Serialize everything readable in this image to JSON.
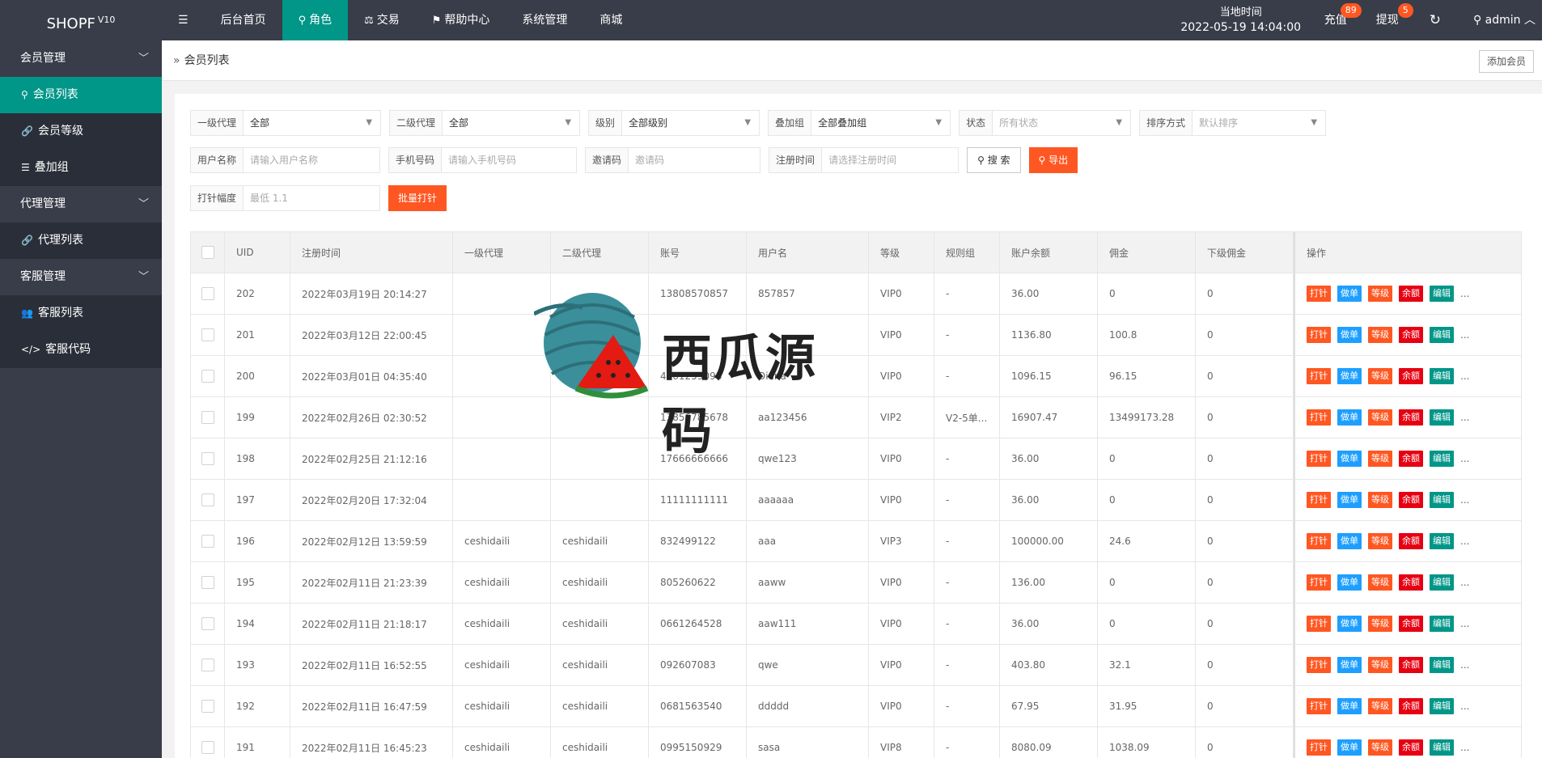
{
  "header": {
    "logo": "SHOPF",
    "logo_version": "V10",
    "menu_glyph": "☰",
    "nav": [
      {
        "label": "后台首页",
        "icon": ""
      },
      {
        "label": "角色",
        "icon": "⚲"
      },
      {
        "label": "交易",
        "icon": "⚖"
      },
      {
        "label": "帮助中心",
        "icon": "⚑"
      },
      {
        "label": "系统管理",
        "icon": ""
      },
      {
        "label": "商城",
        "icon": ""
      }
    ],
    "clock_label": "当地时间",
    "clock_value": "2022-05-19 14:04:00",
    "recharge_label": "充值",
    "recharge_badge": "89",
    "withdraw_label": "提现",
    "withdraw_badge": "5",
    "refresh_glyph": "↻",
    "user_glyph": "⚲",
    "user_label": "admin",
    "user_caret": "︿"
  },
  "sidebar": {
    "groups": [
      {
        "label": "会员管理",
        "items": [
          {
            "label": "会员列表",
            "icon": "⚲"
          },
          {
            "label": "会员等级",
            "icon": "🔗"
          },
          {
            "label": "叠加组",
            "icon": "☰"
          }
        ]
      },
      {
        "label": "代理管理",
        "items": [
          {
            "label": "代理列表",
            "icon": "🔗"
          }
        ]
      },
      {
        "label": "客服管理",
        "items": [
          {
            "label": "客服列表",
            "icon": "👥"
          },
          {
            "label": "客服代码",
            "icon": "</>"
          }
        ]
      }
    ],
    "chevron": "﹀"
  },
  "breadcrumb": {
    "sep": "»",
    "current": "会员列表"
  },
  "add_member_label": "添加会员",
  "filters": {
    "agent1": {
      "label": "一级代理",
      "value": "全部"
    },
    "agent2": {
      "label": "二级代理",
      "value": "全部"
    },
    "level": {
      "label": "级别",
      "value": "全部级别"
    },
    "group": {
      "label": "叠加组",
      "value": "全部叠加组"
    },
    "status": {
      "label": "状态",
      "value": "所有状态"
    },
    "sort": {
      "label": "排序方式",
      "value": "默认排序"
    },
    "username": {
      "label": "用户名称",
      "placeholder": "请输入用户名称"
    },
    "phone": {
      "label": "手机号码",
      "placeholder": "请输入手机号码"
    },
    "invite": {
      "label": "邀请码",
      "placeholder": "邀请码"
    },
    "regtime": {
      "label": "注册时间",
      "placeholder": "请选择注册时间"
    },
    "search_label": "搜 索",
    "export_label": "导出",
    "range": {
      "label": "打针幅度",
      "placeholder": "最低 1.1"
    },
    "batch_label": "批量打针",
    "caret": "▼"
  },
  "table": {
    "columns": [
      "UID",
      "注册时间",
      "一级代理",
      "二级代理",
      "账号",
      "用户名",
      "等级",
      "规则组",
      "账户余额",
      "佣金",
      "下级佣金",
      "操作"
    ],
    "actions": [
      "打针",
      "做单",
      "等级",
      "余额",
      "编辑"
    ],
    "more": "...",
    "rows": [
      [
        "202",
        "2022年03月19日 20:14:27",
        "",
        "",
        "13808570857",
        "857857",
        "VIP0",
        "-",
        "36.00",
        "0",
        "0"
      ],
      [
        "201",
        "2022年03月12日 22:00:45",
        "",
        "",
        "",
        "",
        "VIP0",
        "-",
        "1136.80",
        "100.8",
        "0"
      ],
      [
        "200",
        "2022年03月01日 04:35:40",
        "",
        "",
        "4461259098",
        "Diana",
        "VIP0",
        "-",
        "1096.15",
        "96.15",
        "0"
      ],
      [
        "199",
        "2022年02月26日 02:30:52",
        "",
        "",
        "13856785678",
        "aa123456",
        "VIP2",
        "V2-5单...",
        "16907.47",
        "13499173.28",
        "0"
      ],
      [
        "198",
        "2022年02月25日 21:12:16",
        "",
        "",
        "17666666666",
        "qwe123",
        "VIP0",
        "-",
        "36.00",
        "0",
        "0"
      ],
      [
        "197",
        "2022年02月20日 17:32:04",
        "",
        "",
        "11111111111",
        "aaaaaa",
        "VIP0",
        "-",
        "36.00",
        "0",
        "0"
      ],
      [
        "196",
        "2022年02月12日 13:59:59",
        "ceshidaili",
        "ceshidaili",
        "832499122",
        "aaa",
        "VIP3",
        "-",
        "100000.00",
        "24.6",
        "0"
      ],
      [
        "195",
        "2022年02月11日 21:23:39",
        "ceshidaili",
        "ceshidaili",
        "805260622",
        "aaww",
        "VIP0",
        "-",
        "136.00",
        "0",
        "0"
      ],
      [
        "194",
        "2022年02月11日 21:18:17",
        "ceshidaili",
        "ceshidaili",
        "0661264528",
        "aaw111",
        "VIP0",
        "-",
        "36.00",
        "0",
        "0"
      ],
      [
        "193",
        "2022年02月11日 16:52:55",
        "ceshidaili",
        "ceshidaili",
        "092607083",
        "qwe",
        "VIP0",
        "-",
        "403.80",
        "32.1",
        "0"
      ],
      [
        "192",
        "2022年02月11日 16:47:59",
        "ceshidaili",
        "ceshidaili",
        "0681563540",
        "ddddd",
        "VIP0",
        "-",
        "67.95",
        "31.95",
        "0"
      ],
      [
        "191",
        "2022年02月11日 16:45:23",
        "ceshidaili",
        "ceshidaili",
        "0995150929",
        "sasa",
        "VIP8",
        "-",
        "8080.09",
        "1038.09",
        "0"
      ]
    ]
  },
  "watermark": {
    "text": "西瓜源码"
  },
  "colors": {
    "topbar": "#393d49",
    "accent": "#009688",
    "orange": "#ff5722",
    "blue": "#1e9fff",
    "red": "#e60012"
  }
}
